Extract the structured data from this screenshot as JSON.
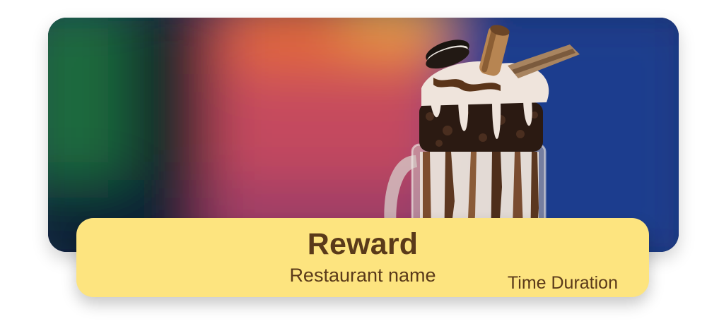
{
  "hero": {
    "image": "milkshake-photo"
  },
  "banner": {
    "title": "Reward",
    "restaurant": "Restaurant name",
    "duration": "Time Duration"
  },
  "colors": {
    "banner_bg": "#fde47f",
    "text": "#5a3a1a"
  }
}
